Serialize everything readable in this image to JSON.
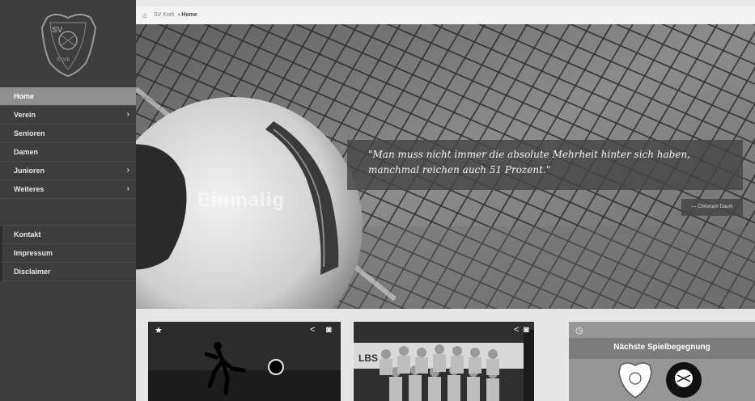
{
  "sidebar": {
    "items": [
      {
        "label": "Home",
        "chevron": ""
      },
      {
        "label": "Verein",
        "chevron": "›"
      },
      {
        "label": "Senioren",
        "chevron": ""
      },
      {
        "label": "Damen",
        "chevron": ""
      },
      {
        "label": "Junioren",
        "chevron": "›"
      },
      {
        "label": "Weiteres",
        "chevron": "›"
      }
    ],
    "secondary_items": [
      {
        "label": "Kontakt"
      },
      {
        "label": "Impressum"
      },
      {
        "label": "Disclaimer"
      }
    ]
  },
  "breadcrumb": {
    "home_icon": "⌂",
    "crumb1": "SV Kork",
    "crumb2": "› Home"
  },
  "hero": {
    "title": "Einmalig",
    "quote_line1": "\"Man muss nicht immer die absolute Mehrheit hinter sich haben,",
    "quote_line2": "manchmal reichen auch 51 Prozent.\"",
    "author": "— Christoph Daum"
  },
  "cards": {
    "card1": {
      "star_icon": "★",
      "share_icon": "<",
      "camera_icon": "◙"
    },
    "card2": {
      "banner_text": "LBS",
      "share_icon": "<",
      "camera_icon": "◙"
    },
    "card3": {
      "clock_icon": "◷",
      "title": "Nächste Spielbegegnung"
    }
  }
}
